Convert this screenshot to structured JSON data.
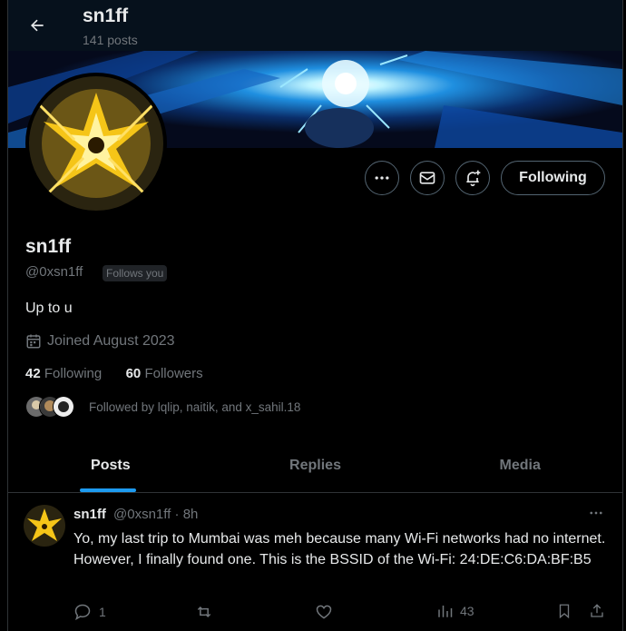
{
  "header": {
    "name": "sn1ff",
    "posts_count": "141 posts"
  },
  "profile": {
    "display_name": "sn1ff",
    "handle": "@0xsn1ff",
    "follows_you_badge": "Follows you",
    "bio": "Up to u",
    "joined": "Joined August 2023",
    "following_count": "42",
    "following_label": "Following",
    "followers_count": "60",
    "followers_label": "Followers",
    "followed_by": "Followed by lqlip, naitik, and x_sahil.18"
  },
  "actions": {
    "follow_button": "Following"
  },
  "tabs": [
    {
      "label": "Posts",
      "active": true
    },
    {
      "label": "Replies",
      "active": false
    },
    {
      "label": "Media",
      "active": false
    }
  ],
  "post": {
    "name": "sn1ff",
    "handle": "@0xsn1ff",
    "separator": "·",
    "time": "8h",
    "text": "Yo, my last trip to Mumbai was meh because many Wi-Fi networks had no internet. However, I finally found one. This is the BSSID of the Wi-Fi: 24:DE:C6:DA:BF:B5",
    "replies": "1",
    "reposts": "",
    "likes": "",
    "views": "43"
  },
  "colors": {
    "accent": "#1d9bf0",
    "muted": "#71767b",
    "text": "#e7e9ea",
    "border": "#2f3336"
  },
  "icons": [
    "back-arrow-icon",
    "more-icon",
    "mail-icon",
    "notification-bell-icon",
    "calendar-icon",
    "reply-icon",
    "repost-icon",
    "like-icon",
    "views-icon",
    "bookmark-icon",
    "share-icon"
  ]
}
